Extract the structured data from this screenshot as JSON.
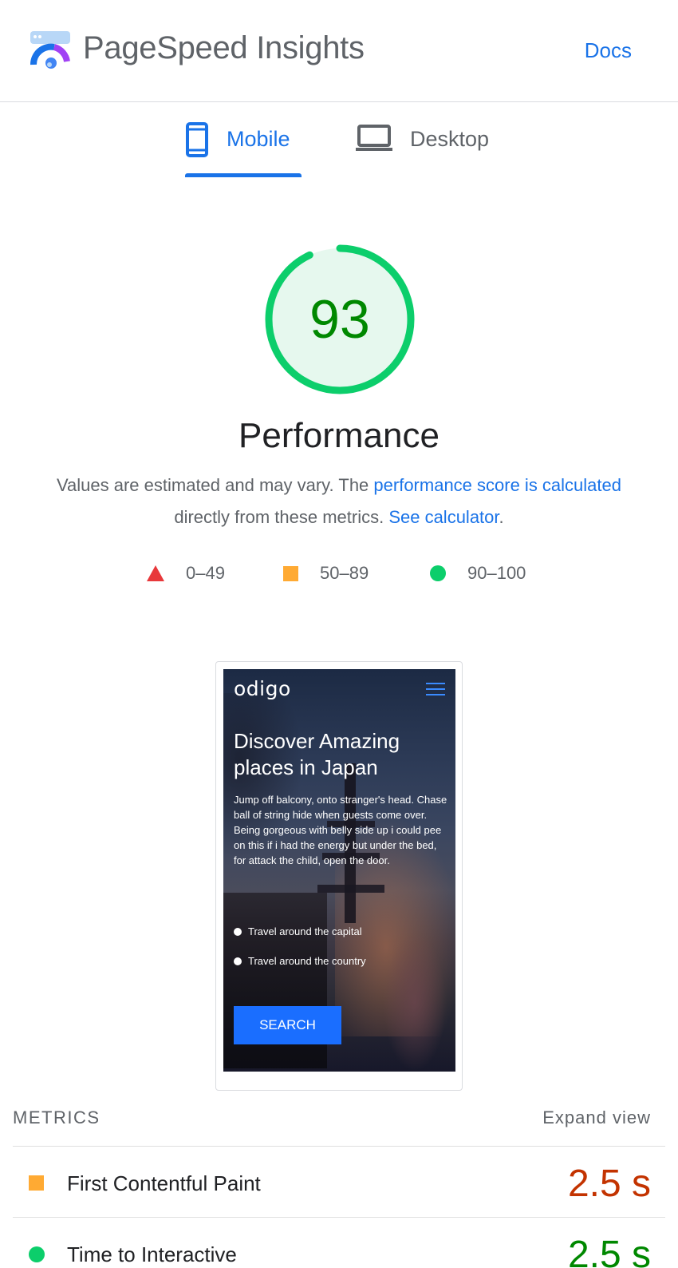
{
  "header": {
    "app_title": "PageSpeed Insights",
    "docs_label": "Docs"
  },
  "tabs": [
    {
      "label": "Mobile",
      "icon": "mobile-phone-icon",
      "active": true
    },
    {
      "label": "Desktop",
      "icon": "laptop-icon",
      "active": false
    }
  ],
  "score": {
    "value": "93",
    "fraction": 0.93,
    "category": "Performance",
    "color": "#0cce6b",
    "text_color": "#008800"
  },
  "description": {
    "text_before": "Values are estimated and may vary. The ",
    "link1": "performance score is calculated",
    "text_middle": " directly from these metrics. ",
    "link2": "See calculator",
    "text_after": "."
  },
  "legend": [
    {
      "range": "0–49",
      "shape": "triangle",
      "color": "#e8383b"
    },
    {
      "range": "50–89",
      "shape": "square",
      "color": "#ffaa33"
    },
    {
      "range": "90–100",
      "shape": "circle",
      "color": "#0cce6b"
    }
  ],
  "screenshot": {
    "site_logo": "odigo",
    "heading": "Discover Amazing places in Japan",
    "paragraph": "Jump off balcony, onto stranger's head. Chase ball of string hide when guests come over. Being gorgeous with belly side up i could pee on this if i had the energy but under the bed, for attack the child, open the door.",
    "options": [
      "Travel around the capital",
      "Travel around the country"
    ],
    "button": "SEARCH"
  },
  "metrics": {
    "title": "METRICS",
    "expand_label": "Expand view",
    "rows": [
      {
        "label": "First Contentful Paint",
        "value": "2.5 s",
        "status": "average"
      },
      {
        "label": "Time to Interactive",
        "value": "2.5 s",
        "status": "pass"
      }
    ]
  }
}
